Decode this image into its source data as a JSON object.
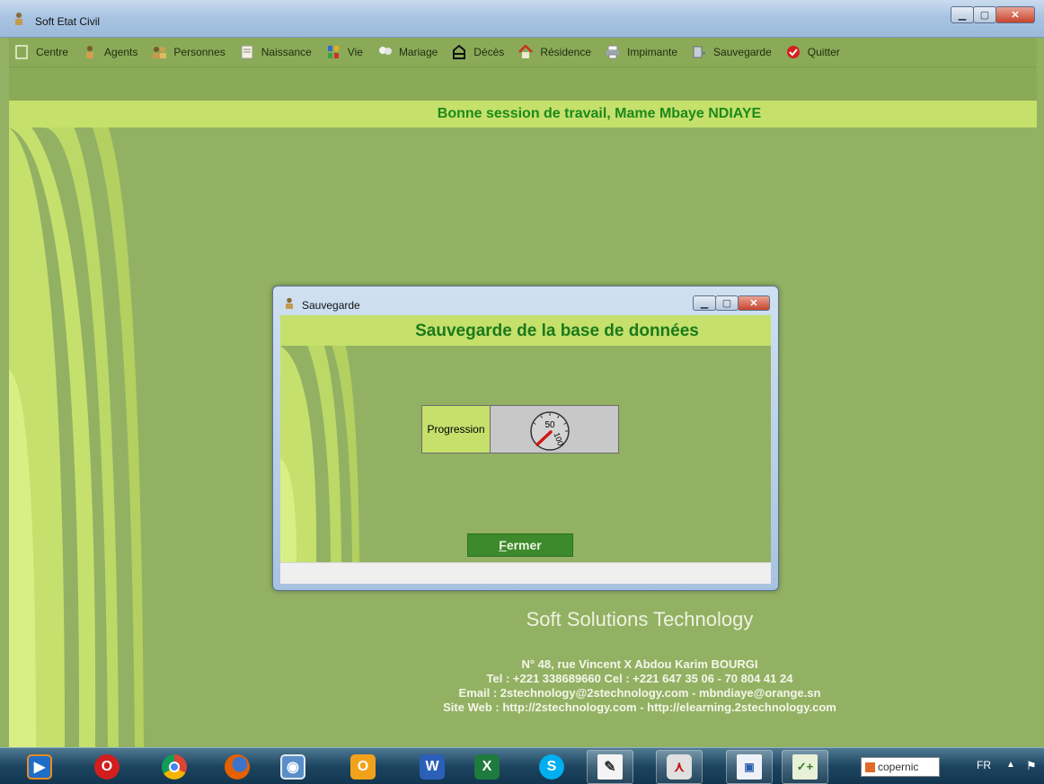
{
  "window": {
    "title": "Soft Etat Civil"
  },
  "menu": [
    {
      "label": "Centre",
      "icon": "blank-page-icon"
    },
    {
      "label": "Agents",
      "icon": "agent-icon"
    },
    {
      "label": "Personnes",
      "icon": "people-icon"
    },
    {
      "label": "Naissance",
      "icon": "document-icon"
    },
    {
      "label": "Vie",
      "icon": "blocks-icon"
    },
    {
      "label": "Mariage",
      "icon": "couple-icon"
    },
    {
      "label": "Décès",
      "icon": "coffin-icon"
    },
    {
      "label": "Résidence",
      "icon": "house-icon"
    },
    {
      "label": "Impimante",
      "icon": "printer-icon"
    },
    {
      "label": "Sauvegarde",
      "icon": "backup-icon"
    },
    {
      "label": "Quitter",
      "icon": "check-circle-icon"
    }
  ],
  "greeting": "Bonne session de travail, Mame Mbaye NDIAYE",
  "dialog": {
    "title": "Sauvegarde",
    "heading": "Sauvegarde de la base de données",
    "progress_label": "Progression",
    "gauge_labels": [
      "50",
      "100"
    ],
    "close_first_letter": "F",
    "close_rest": "ermer"
  },
  "company": {
    "name": "Soft Solutions Technology",
    "address": "N° 48, rue Vincent X Abdou Karim BOURGI",
    "phone": "Tel : +221 338689660 Cel : +221 647 35 06 - 70 804 41 24",
    "email": "Email : 2stechnology@2stechnology.com - mbndiaye@orange.sn",
    "web": "Site Web : http://2stechnology.com - http://elearning.2stechnology.com"
  },
  "taskbar": {
    "search_text": "copernic",
    "language": "FR",
    "apps": [
      "media-player-icon",
      "opera-icon",
      "chrome-icon",
      "firefox-icon",
      "app-icon",
      "outlook-icon",
      "word-icon",
      "excel-icon",
      "skype-icon",
      "notepad-icon",
      "acrobat-icon",
      "window-icon",
      "notepad-plus-icon"
    ]
  },
  "colors": {
    "accent_green": "#1b8a1b",
    "panel_lime": "#c5e06b",
    "background_olive": "#93b163"
  }
}
